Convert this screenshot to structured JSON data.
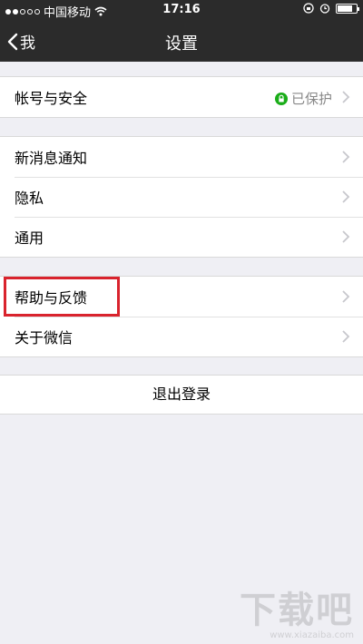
{
  "status_bar": {
    "carrier": "中国移动",
    "time": "17:16"
  },
  "nav": {
    "back_label": "我",
    "title": "设置"
  },
  "groups": [
    {
      "items": [
        {
          "label": "帐号与安全",
          "value": "已保护"
        }
      ]
    },
    {
      "items": [
        {
          "label": "新消息通知"
        },
        {
          "label": "隐私"
        },
        {
          "label": "通用"
        }
      ]
    },
    {
      "items": [
        {
          "label": "帮助与反馈"
        },
        {
          "label": "关于微信"
        }
      ]
    }
  ],
  "logout_label": "退出登录",
  "watermark": {
    "text": "下载吧",
    "url": "www.xiazaiba.com"
  },
  "colors": {
    "nav_bg": "#2b2b2b",
    "page_bg": "#efeff4",
    "lock_green": "#1aad19",
    "highlight_red": "#d9232d"
  }
}
